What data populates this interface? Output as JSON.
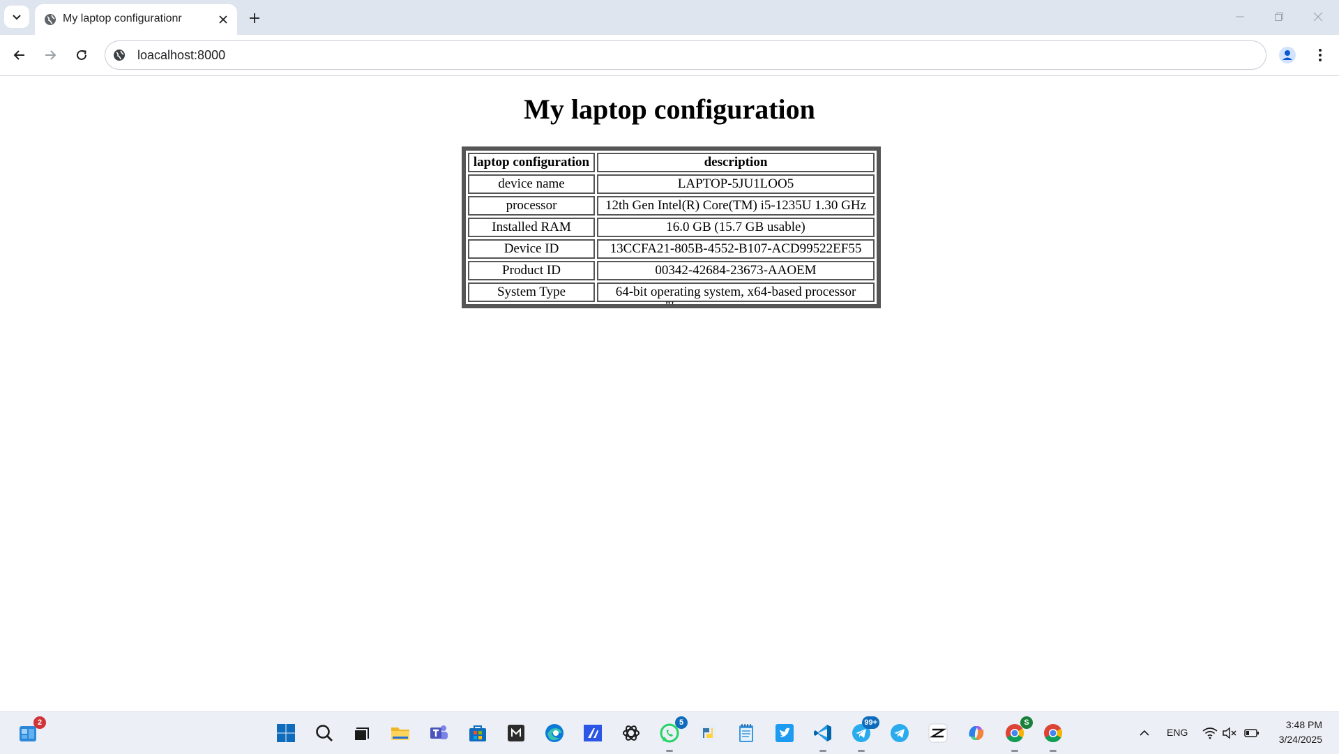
{
  "browser": {
    "tab_title": "My laptop configurationr",
    "url": "loacalhost:8000",
    "icons": [
      "tab-search-icon",
      "globe-icon",
      "close-icon",
      "plus-icon",
      "minimize-icon",
      "restore-icon",
      "window-close-icon",
      "back-arrow-icon",
      "forward-arrow-icon",
      "reload-icon",
      "site-info-icon",
      "profile-icon",
      "kebab-menu-icon"
    ]
  },
  "page": {
    "title": "My laptop configuration",
    "table": {
      "headers": [
        "laptop configuration",
        "description"
      ],
      "rows": [
        [
          "device name",
          "LAPTOP-5JU1LOO5"
        ],
        [
          "processor",
          "12th Gen Intel(R) Core(TM) i5-1235U 1.30 GHz"
        ],
        [
          "Installed RAM",
          "16.0 GB (15.7 GB usable)"
        ],
        [
          "Device ID",
          "13CCFA21-805B-4552-B107-ACD99522EF55"
        ],
        [
          "Product ID",
          "00342-42684-23673-AAOEM"
        ],
        [
          "System Type",
          "64-bit operating system, x64-based processor"
        ]
      ]
    },
    "stray_text": "\"'"
  },
  "taskbar": {
    "widgets_badge": "2",
    "whatsapp_badge": "5",
    "telegram_badge": "99+",
    "chrome_profile_badge": "S",
    "language": "ENG",
    "time": "3:48 PM",
    "date": "3/24/2025",
    "colors": {
      "badge_red": "#d13438",
      "badge_blue": "#0f6cbd",
      "badge_green": "#188038"
    }
  }
}
